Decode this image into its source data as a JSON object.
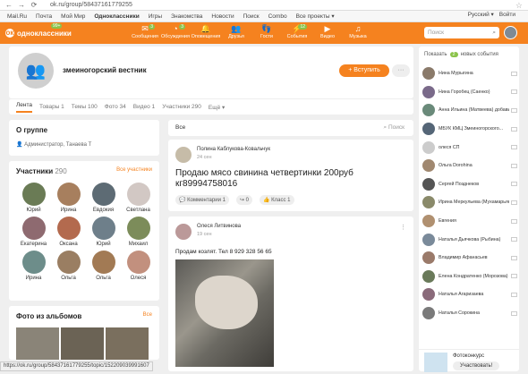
{
  "browser": {
    "url": "ok.ru/group/58437161779255"
  },
  "topmenu": {
    "items": [
      "Mail.Ru",
      "Почта",
      "Мой Мир",
      "Одноклассники",
      "Игры",
      "Знакомства",
      "Новости",
      "Поиск",
      "Combo",
      "Все проекты ▾"
    ],
    "lang": "Русский ▾",
    "login": "Войти"
  },
  "header": {
    "logo": "одноклассники",
    "logo_badge": "99+",
    "nav": [
      {
        "label": "Сообщения",
        "icon": "✉",
        "badge": "3"
      },
      {
        "label": "Обсуждения",
        "icon": "◔",
        "badge": "3"
      },
      {
        "label": "Оповещения",
        "icon": "🔔",
        "badge": ""
      },
      {
        "label": "Друзья",
        "icon": "👥",
        "badge": ""
      },
      {
        "label": "Гости",
        "icon": "👣",
        "badge": ""
      },
      {
        "label": "События",
        "icon": "⚡",
        "badge": "12"
      },
      {
        "label": "Видео",
        "icon": "▶",
        "badge": ""
      },
      {
        "label": "Музыка",
        "icon": "♫",
        "badge": ""
      }
    ],
    "search_placeholder": "Поиск"
  },
  "group": {
    "name": "змеиногорский вестник",
    "join": "+ Вступить",
    "more": "···"
  },
  "tabs": [
    "Лента",
    "Товары 1",
    "Темы 100",
    "Фото 34",
    "Видео 1",
    "Участники 290",
    "Ещё ▾"
  ],
  "about": {
    "title": "О группе",
    "admin": "Администратор, Танаева Т"
  },
  "members": {
    "title": "Участники",
    "count": "290",
    "all": "Все участники",
    "list": [
      "Юрий",
      "Ирина",
      "Евдокия",
      "Светлана",
      "Екатерина",
      "Оксана",
      "Юрий",
      "Михаил",
      "Ирина",
      "Ольга",
      "Ольга",
      "Олеся"
    ]
  },
  "photos": {
    "title": "Фото из альбомов",
    "all": "Все"
  },
  "feed": {
    "all": "Все",
    "search": "Поиск"
  },
  "post1": {
    "author": "Полина Каблукова-Ковальчук",
    "date": "24 сен",
    "text": "Продаю мясо свинина четвертинки 200руб кг89994758016",
    "comments": "Комментарии",
    "comments_count": "1",
    "reshare": "0",
    "like": "Класс",
    "like_count": "1"
  },
  "post2": {
    "author": "Олеся Литвинова",
    "date": "19 сен",
    "text": "Продам козлят. Тел 8 929 328 56 65"
  },
  "events": {
    "show": "Показать",
    "count": "2",
    "label": "новых события"
  },
  "friends": [
    "Нина Мурыгина",
    "Нина Горобец (Саенко)",
    "Анна Ильина (Матвеева) добавила в друзья Макарова Сергея",
    "МБУК КМЦ Змеиногорского...",
    "олеся СП",
    "Ольга Dorohina",
    "Сергей Позднеков",
    "Ирина Меркульева (Мухамарьянова)",
    "Евгения",
    "Наталья Дьячкова (Рыбина)",
    "Владимир Афанасьев",
    "Елена Кондратенко (Морозова)",
    "Наталья Агаризаева",
    "Наталья Сорокина"
  ],
  "contest": {
    "title": "Фотоконкурс",
    "btn": "Участвовать!"
  },
  "status": "https://ok.ru/group/58437161779255/topic/152209039991607"
}
